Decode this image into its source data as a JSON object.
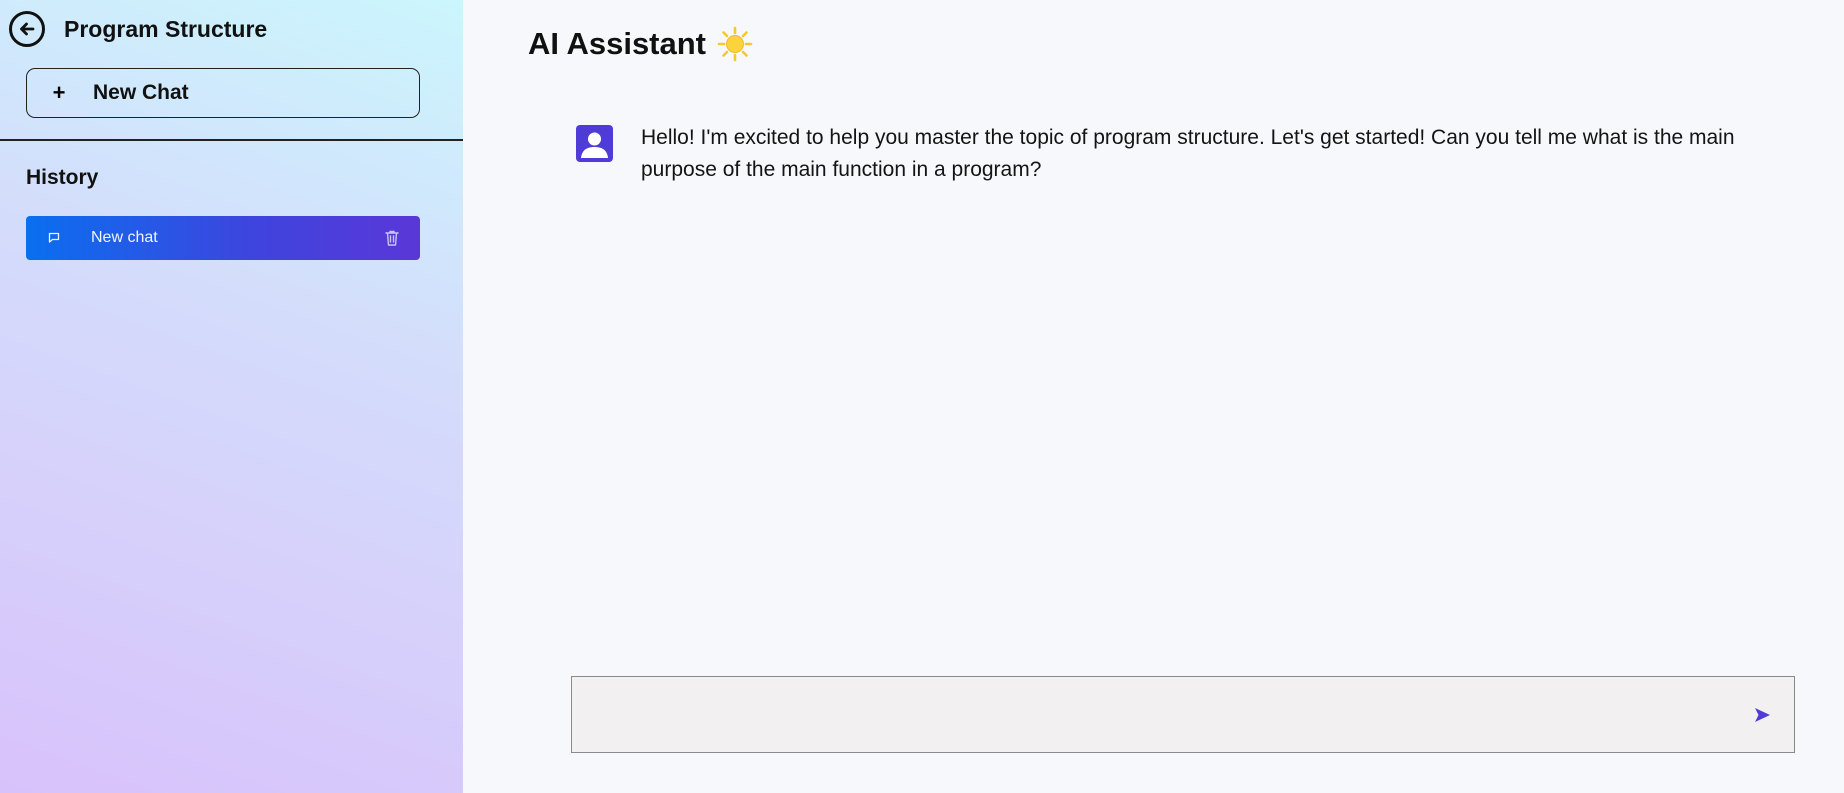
{
  "sidebar": {
    "title": "Program Structure",
    "back_icon": "arrow-left-circle-icon",
    "new_chat_plus": "+",
    "new_chat_label": "New Chat",
    "history_label": "History",
    "history_items": [
      {
        "label": "New chat",
        "icon": "message-icon",
        "action_icon": "trash-icon"
      }
    ]
  },
  "main": {
    "title": "AI Assistant",
    "title_icon": "sun-icon",
    "messages": [
      {
        "role": "assistant",
        "avatar_icon": "user-avatar-icon",
        "text": "Hello! I'm excited to help you master the topic of program structure. Let's get started! Can you tell me what is the main purpose of the main function in a program?"
      }
    ],
    "input": {
      "value": "",
      "placeholder": ""
    },
    "send_icon": "send-icon"
  },
  "colors": {
    "accent": "#4f3bd6",
    "chat_item_gradient_start": "#0a6ff0",
    "chat_item_gradient_end": "#5a38d8",
    "sun": "#f7c730"
  }
}
